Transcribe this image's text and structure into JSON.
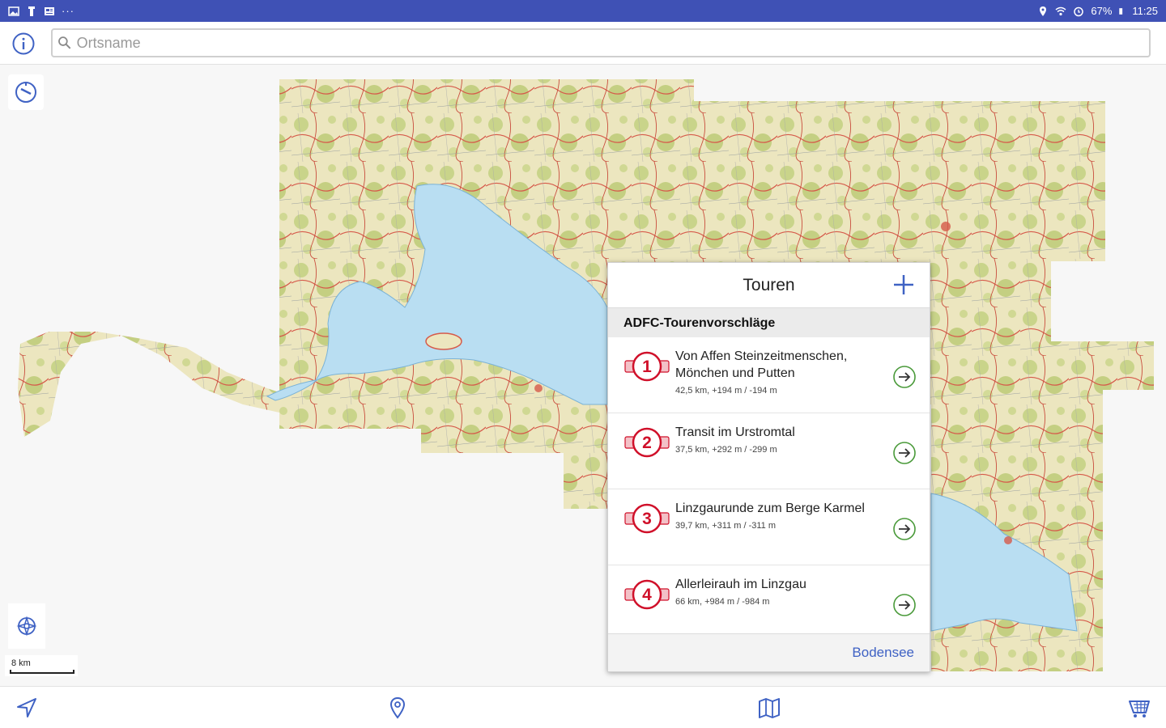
{
  "status_bar": {
    "battery": "67%",
    "time": "11:25",
    "left_icons": [
      "gallery-icon",
      "usb-icon",
      "news-icon",
      "more-dots-icon"
    ],
    "right_icons": [
      "location-icon",
      "wifi-icon",
      "alarm-icon",
      "battery-icon"
    ]
  },
  "search": {
    "placeholder": "Ortsname",
    "value": ""
  },
  "map": {
    "scale_label": "8 km"
  },
  "tours_panel": {
    "title": "Touren",
    "section_title": "ADFC-Tourenvorschläge",
    "tours": [
      {
        "number": "1",
        "title": "Von Affen Steinzeitmenschen, Mönchen und Putten",
        "meta": "42,5 km, +194 m / -194 m"
      },
      {
        "number": "2",
        "title": "Transit im Urstromtal",
        "meta": "37,5 km, +292 m / -299 m"
      },
      {
        "number": "3",
        "title": "Linzgaurunde zum Berge Karmel",
        "meta": "39,7 km, +311 m / -311 m"
      },
      {
        "number": "4",
        "title": "Allerleirauh im Linzgau",
        "meta": "66 km, +984 m / -984 m"
      }
    ],
    "footer_link": "Bodensee"
  },
  "colors": {
    "status_bar": "#3f51b5",
    "accent_blue": "#3f62c4",
    "badge_red": "#d0102a",
    "go_green": "#4a9a3a",
    "lake": "#b9def2"
  },
  "bottom_bar": {
    "icons": [
      "navigate-icon",
      "place-pin-icon",
      "map-book-icon",
      "shop-cart-icon"
    ]
  }
}
